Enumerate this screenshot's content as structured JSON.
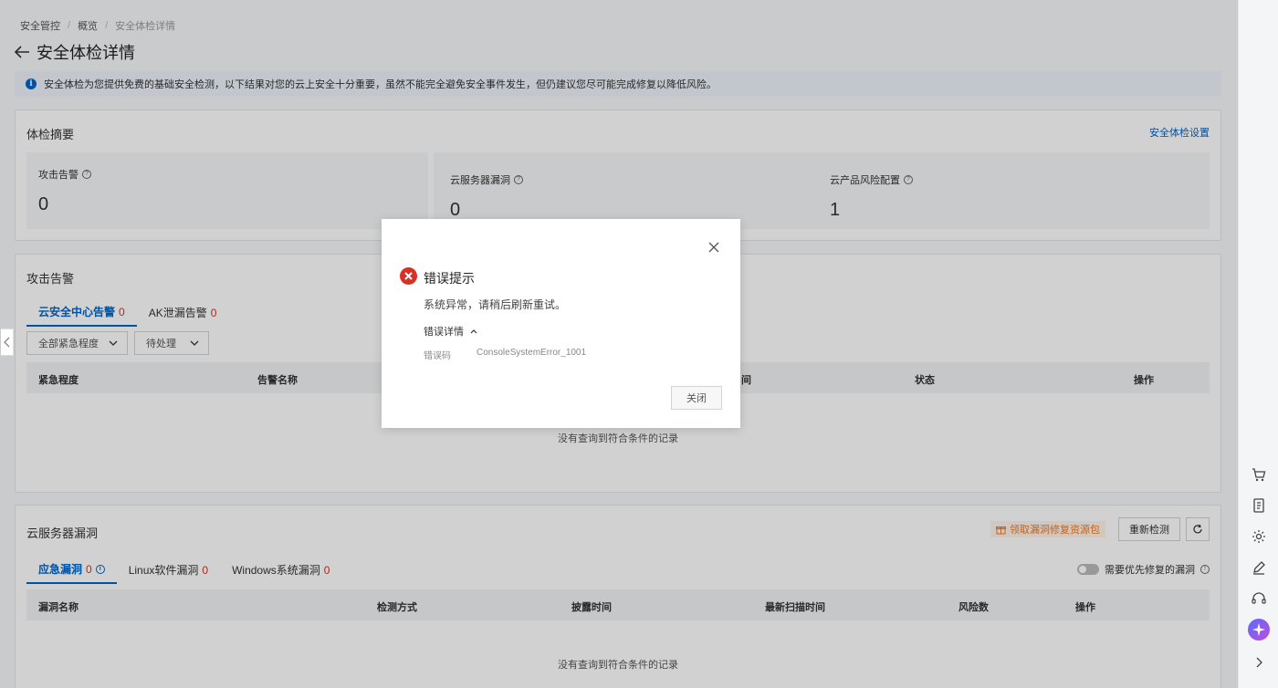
{
  "breadcrumb": {
    "items": [
      "安全管控",
      "概览"
    ],
    "current": "安全体检详情"
  },
  "page": {
    "title": "安全体检详情"
  },
  "info_bar": {
    "text": "安全体检为您提供免费的基础安全检测，以下结果对您的云上安全十分重要，虽然不能完全避免安全事件发生，但仍建议您尽可能完成修复以降低风险。"
  },
  "summary": {
    "title": "体检摘要",
    "settings_link": "安全体检设置",
    "stats": [
      {
        "label": "攻击告警",
        "value": "0"
      },
      {
        "label": "云服务器漏洞",
        "value": "0"
      },
      {
        "label": "云产品风险配置",
        "value": "1"
      }
    ]
  },
  "attack": {
    "title": "攻击告警",
    "tabs": [
      {
        "label": "云安全中心告警",
        "count": "0"
      },
      {
        "label": "AK泄漏告警",
        "count": "0"
      }
    ],
    "filters": {
      "severity": "全部紧急程度",
      "status": "待处理"
    },
    "columns": [
      "紧急程度",
      "告警名称",
      "间",
      "状态",
      "操作"
    ],
    "empty_text": "没有查询到符合条件的记录"
  },
  "vuln": {
    "title": "云服务器漏洞",
    "promo_label": "领取漏洞修复资源包",
    "recheck_label": "重新检测",
    "tabs": [
      {
        "label": "应急漏洞",
        "count": "0"
      },
      {
        "label": "Linux软件漏洞",
        "count": "0"
      },
      {
        "label": "Windows系统漏洞",
        "count": "0"
      }
    ],
    "toggle_label": "需要优先修复的漏洞",
    "columns": [
      "漏洞名称",
      "检测方式",
      "披露时间",
      "最新扫描时间",
      "风险数",
      "操作"
    ],
    "empty_text": "没有查询到符合条件的记录"
  },
  "modal": {
    "title": "错误提示",
    "message": "系统异常，请稍后刷新重试。",
    "details_toggle": "错误详情",
    "code_label": "错误码",
    "code_value": "ConsoleSystemError_1001",
    "close_label": "关闭"
  },
  "colors": {
    "accent": "#0064c8",
    "error": "#d93026",
    "promo": "#e87a2a"
  },
  "right_bar": {
    "icons": [
      "cart-icon",
      "document-icon",
      "gear-icon",
      "edit-icon",
      "headset-icon",
      "assistant-icon",
      "chevron-right-icon"
    ]
  }
}
